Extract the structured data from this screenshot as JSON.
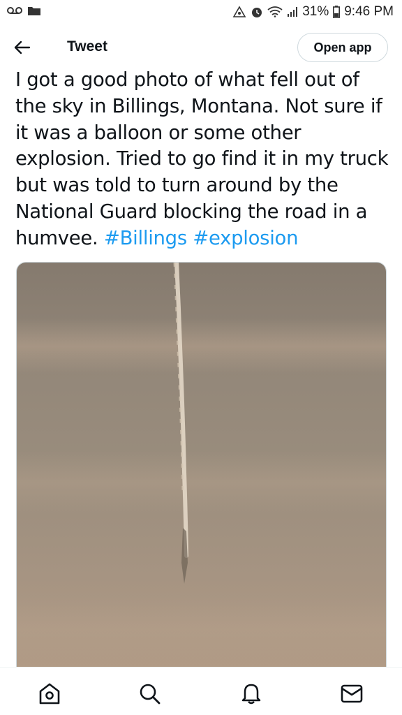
{
  "status_bar": {
    "battery": "31%",
    "time": "9:46 PM"
  },
  "header": {
    "title": "Tweet",
    "open_app_label": "Open app",
    "back_icon": "arrow-left-icon"
  },
  "tweet": {
    "text": "I got a good photo of what fell out of the sky in Billings, Montana. Not sure if it was a balloon or some other explosion. Tried to go find it in my truck but was told to turn around by the National Guard blocking the road in a humvee.",
    "hashtags": [
      "#Billings",
      "#explosion"
    ]
  },
  "bottom_nav": {
    "items": [
      "home-icon",
      "search-icon",
      "notifications-icon",
      "messages-icon"
    ]
  },
  "colors": {
    "link": "#1d9bf0",
    "text": "#0f1419",
    "sky_top": "#8a7f72",
    "sky_bottom": "#b09a84"
  }
}
